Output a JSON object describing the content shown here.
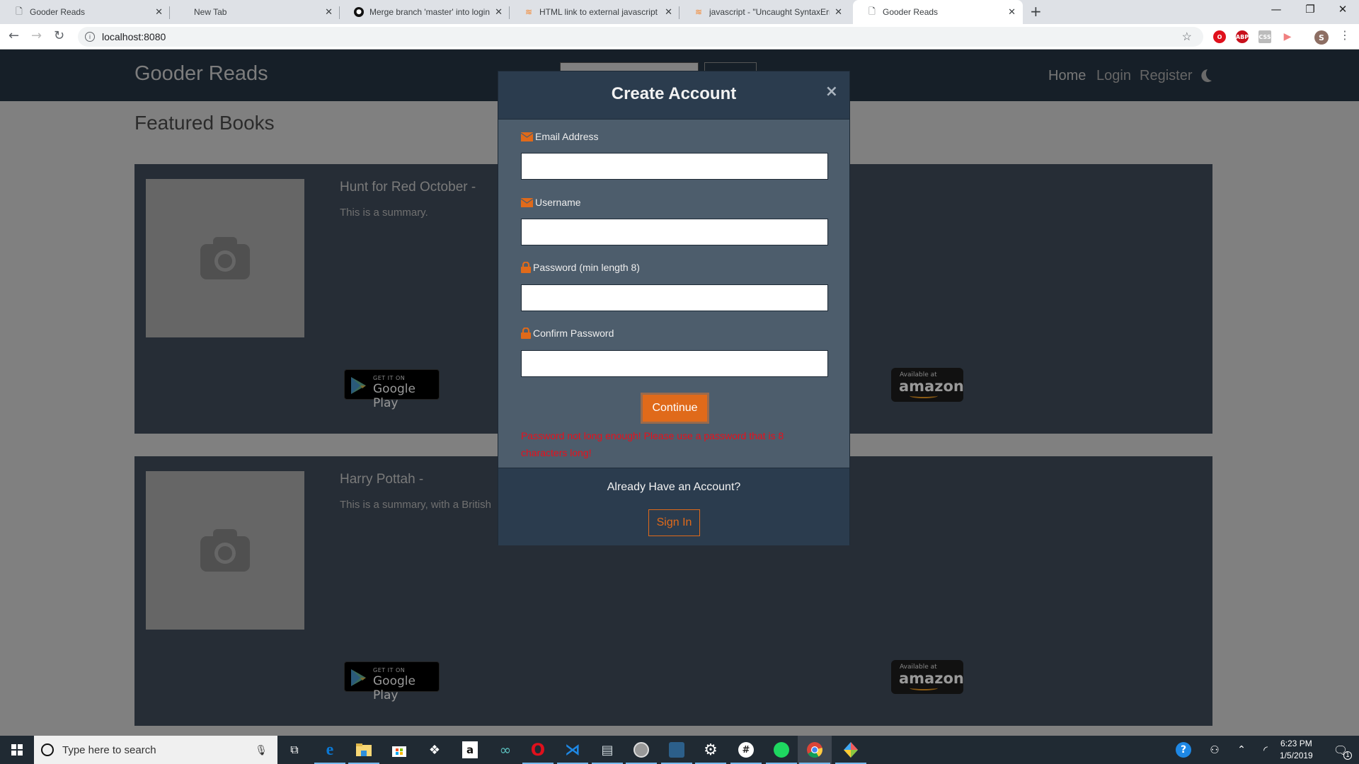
{
  "browser": {
    "tabs": [
      {
        "title": "Gooder Reads",
        "icon": "page-icon",
        "active": false
      },
      {
        "title": "New Tab",
        "icon": "none",
        "active": false
      },
      {
        "title": "Merge branch 'master' into login",
        "icon": "github-icon",
        "active": false
      },
      {
        "title": "HTML link to external javascript n",
        "icon": "stackoverflow-icon",
        "active": false
      },
      {
        "title": "javascript - \"Uncaught SyntaxErro",
        "icon": "stackoverflow-icon",
        "active": false
      },
      {
        "title": "Gooder Reads",
        "icon": "page-icon",
        "active": true
      }
    ],
    "close_glyph": "✕",
    "new_tab_glyph": "+",
    "window_controls": {
      "minimize": "—",
      "restore": "❐",
      "close": "✕"
    },
    "url": "localhost:8080",
    "extensions": [
      {
        "name": "opera-ext",
        "label": "O",
        "color": "#e0101c"
      },
      {
        "name": "adblock-plus",
        "label": "ABP",
        "color": "#c8101c"
      },
      {
        "name": "css-ext",
        "label": "CSS",
        "color": "#bbbbbb"
      },
      {
        "name": "cast-ext",
        "label": "▶",
        "color": "#f08080"
      }
    ],
    "profile_initial": "S"
  },
  "site": {
    "brand": "Gooder Reads",
    "nav": [
      "Home",
      "Login",
      "Register"
    ],
    "section_title": "Featured Books",
    "books": [
      {
        "title": "Hunt for Red October -",
        "summary": "This is a summary.",
        "google_play": {
          "small": "GET IT ON",
          "big": "Google Play"
        },
        "amazon": {
          "small": "Available at",
          "big": "amazon"
        }
      },
      {
        "title": "Harry Pottah -",
        "summary": "This is a summary, with a British",
        "google_play": {
          "small": "GET IT ON",
          "big": "Google Play"
        },
        "amazon": {
          "small": "Available at",
          "big": "amazon"
        }
      }
    ]
  },
  "modal": {
    "title": "Create Account",
    "close_glyph": "×",
    "fields": [
      {
        "label": "Email Address",
        "icon": "envelope-icon",
        "value": "",
        "placeholder": ""
      },
      {
        "label": "Username",
        "icon": "envelope-icon",
        "value": "",
        "placeholder": ""
      },
      {
        "label": "Password (min length 8)",
        "icon": "lock-icon",
        "value": "",
        "placeholder": ""
      },
      {
        "label": "Confirm Password",
        "icon": "lock-icon",
        "value": "",
        "placeholder": ""
      }
    ],
    "continue_label": "Continue",
    "error": "Password not long enough! Please use a password that is 8 characters long!",
    "footer_text": "Already Have an Account?",
    "signin_label": "Sign In",
    "accent_color": "#e06a1a",
    "error_color": "#e8101c"
  },
  "taskbar": {
    "search_placeholder": "Type here to search",
    "apps": [
      "task-view",
      "edge",
      "file-explorer",
      "store",
      "dropbox",
      "amazon",
      "arduino",
      "opera",
      "vscode",
      "resource-monitor",
      "mamp",
      "mysql-workbench",
      "settings",
      "slack",
      "spotify",
      "chrome",
      "git-kraken"
    ],
    "time": "6:23 PM",
    "date": "1/5/2019",
    "notification_count": "1"
  }
}
